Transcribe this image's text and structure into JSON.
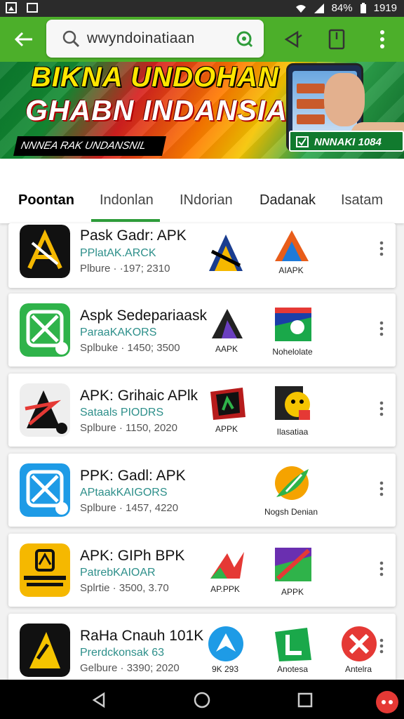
{
  "status": {
    "clock": "1919",
    "extra": "84%"
  },
  "search": {
    "query": "wwyndoinatiaan"
  },
  "banner": {
    "headline_1": "BIKNA UNDOHAN",
    "headline_2": "GHABN INDANSIAI",
    "tagline": "NNNEA RAK UNDANSNIL",
    "badge": "NNNAKI 1084"
  },
  "tabs": [
    "Poontan",
    "Indonlan",
    "INdorian",
    "Dadanak",
    "Isatam"
  ],
  "active_tab": 0,
  "apps": [
    {
      "title": "Pask Gadr: APK",
      "subtitle": "PPlatAK.ARCK",
      "meta": "Plbure · ·197; 2310",
      "minis": [
        {
          "label": ""
        },
        {
          "label": "AIAPK"
        }
      ],
      "icon_color": "#111111"
    },
    {
      "title": "Aspk Sedepariaask",
      "subtitle": "ParaaKAKORS",
      "meta": "Splbuke · 1450; 3500",
      "minis": [
        {
          "label": "AAPK"
        },
        {
          "label": "Nohelolate"
        }
      ],
      "icon_color": "#2fb34a"
    },
    {
      "title": "APK: Grihaic APlk",
      "subtitle": "Sataals PIODRS",
      "meta": "Splbure · 1150, 2020",
      "minis": [
        {
          "label": "APPK"
        },
        {
          "label": "Ilasatiaa"
        }
      ],
      "icon_color": "#f0f0f0"
    },
    {
      "title": "PPK: Gadl: APK",
      "subtitle": "APtaakKAIGORS",
      "meta": "Splbure · 1457, 4220",
      "minis": [
        {
          "label": "Nogsh Denian"
        }
      ],
      "icon_color": "#1e9be6"
    },
    {
      "title": "APK: GIPh BPK",
      "subtitle": "PatrebKAIOAR",
      "meta": "Splrtie · 3500, 3.70",
      "minis": [
        {
          "label": "AP.PPK"
        },
        {
          "label": "APPK"
        }
      ],
      "icon_color": "#f5b800"
    },
    {
      "title": "RaHa Cnauh 101K",
      "subtitle": "Prerdckonsak 63",
      "meta": "Gelbure · 3390; 2020",
      "minis": [
        {
          "label": "9K 293"
        },
        {
          "label": "Anotesa"
        },
        {
          "label": "Antelra"
        }
      ],
      "icon_color": "#111111"
    }
  ],
  "colors": {
    "appbar": "#4caf2a",
    "accent": "#2e9c3a",
    "subtitle": "#2d8f8a"
  },
  "icons": [
    "back-arrow-icon",
    "search-icon",
    "mic-icon",
    "share-icon",
    "bookmark-icon",
    "more-vert-icon",
    "nav-back-icon",
    "nav-home-icon",
    "nav-recents-icon"
  ]
}
